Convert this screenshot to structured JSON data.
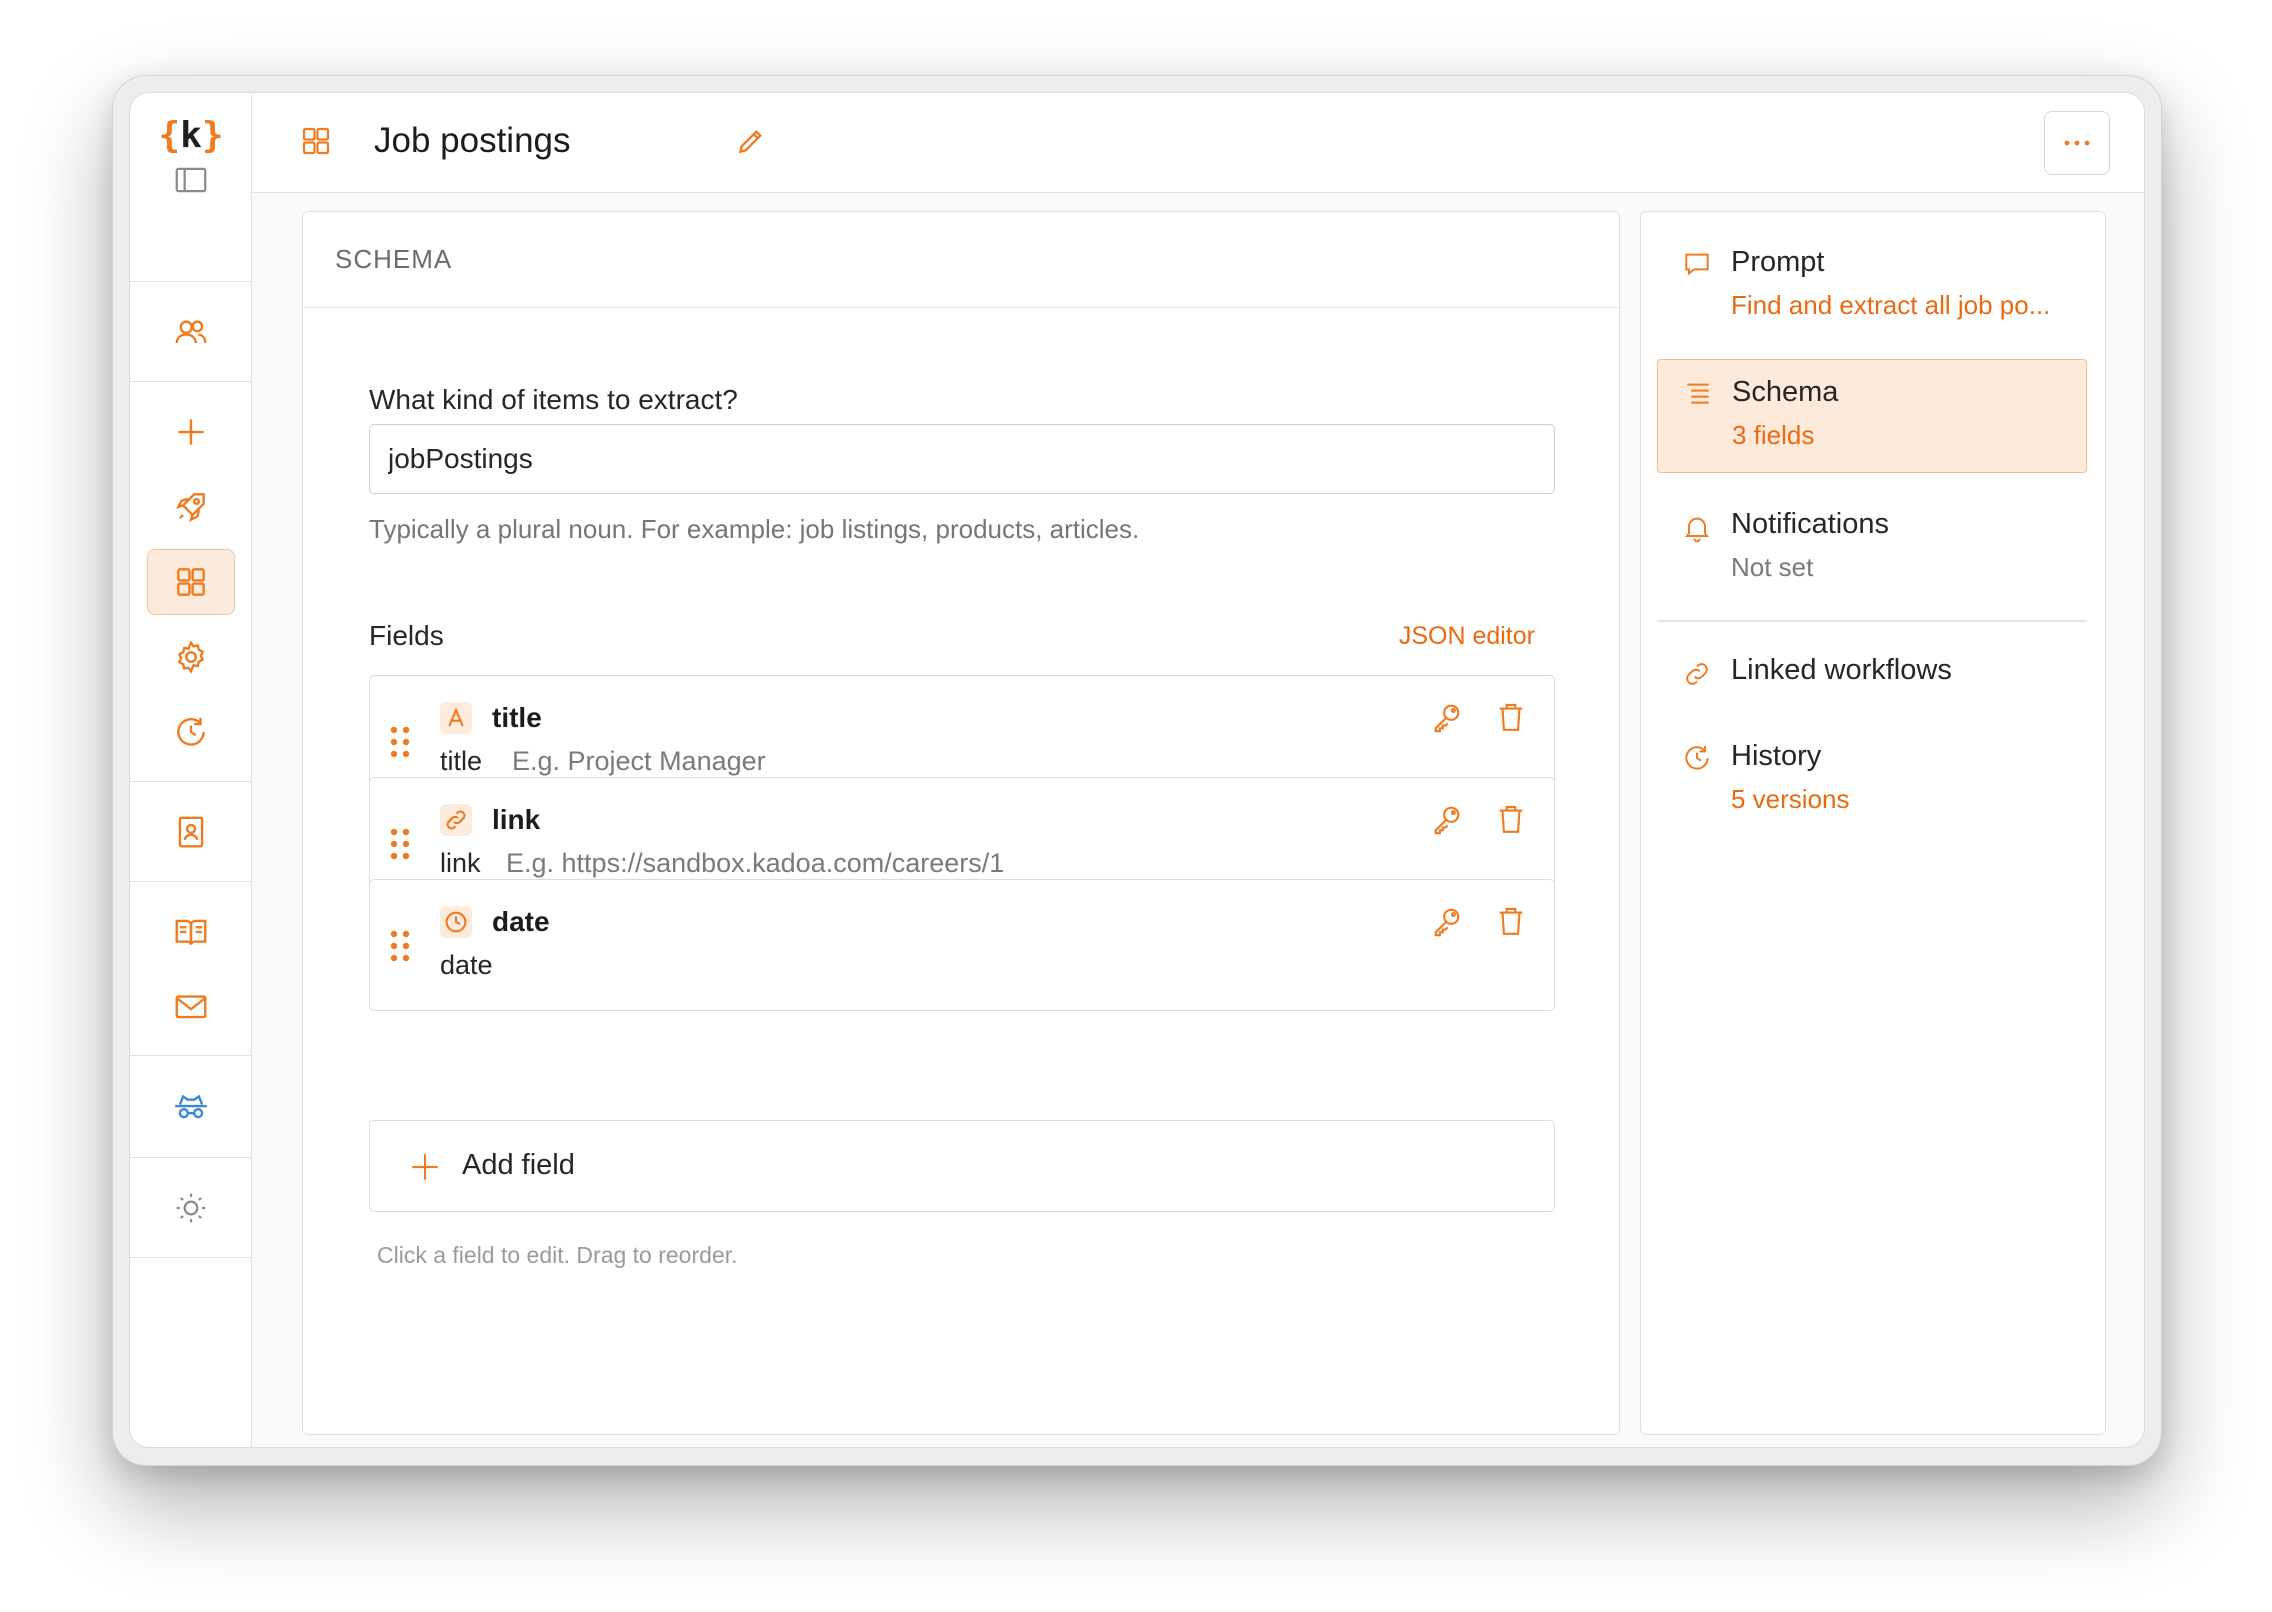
{
  "app": {
    "logo_text": "{k}",
    "logo_left": "{",
    "logo_mid": "k",
    "logo_right": "}"
  },
  "header": {
    "title": "Job postings",
    "more_label": "..."
  },
  "schema": {
    "section_title": "SCHEMA",
    "question": "What kind of items to extract?",
    "input_value": "jobPostings",
    "hint": "Typically a plural noun. For example: job listings, products, articles.",
    "fields_label": "Fields",
    "json_editor": "JSON editor",
    "fields": [
      {
        "name": "title",
        "key": "title",
        "example": "E.g. Project Manager",
        "type_icon": "text-type-icon"
      },
      {
        "name": "link",
        "key": "link",
        "example": "E.g. https://sandbox.kadoa.com/careers/1",
        "type_icon": "link-type-icon"
      },
      {
        "name": "date",
        "key": "date",
        "example": "",
        "type_icon": "clock-type-icon"
      }
    ],
    "add_field": "Add field",
    "footer_hint": "Click a field to edit. Drag to reorder."
  },
  "side": {
    "prompt": {
      "title": "Prompt",
      "subtitle": "Find and extract all job po..."
    },
    "schema": {
      "title": "Schema",
      "subtitle": "3 fields"
    },
    "notifications": {
      "title": "Notifications",
      "subtitle": "Not set"
    },
    "linked": {
      "title": "Linked workflows"
    },
    "history": {
      "title": "History",
      "subtitle": "5 versions"
    }
  },
  "colors": {
    "accent": "#f07a1f",
    "accent_text": "#ea6a12",
    "active_bg": "#fdebdd",
    "blue_icon": "#3a87d6"
  }
}
